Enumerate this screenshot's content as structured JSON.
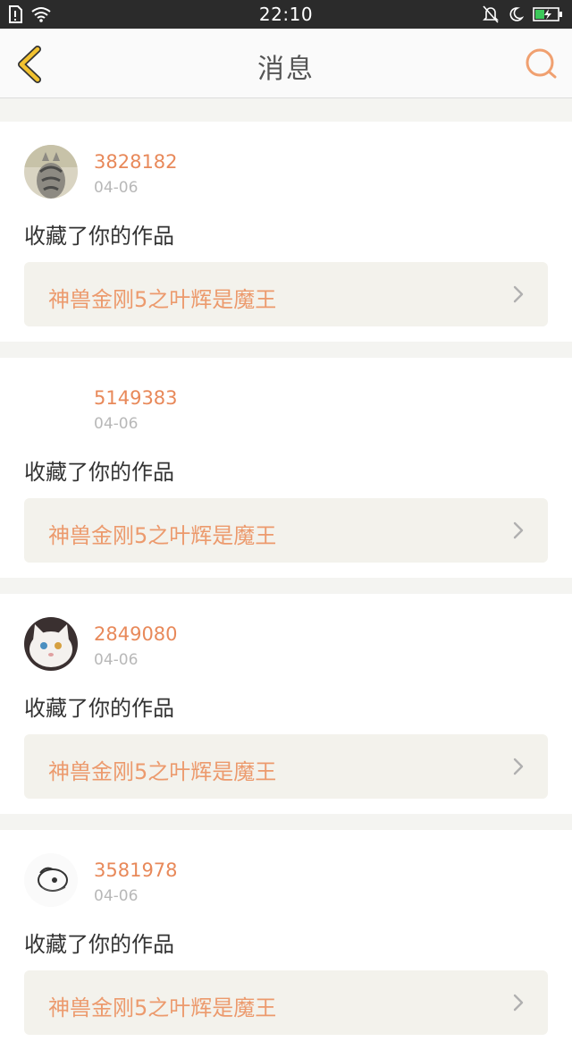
{
  "status_bar": {
    "time": "22:10"
  },
  "header": {
    "title": "消息"
  },
  "messages": [
    {
      "user": "3828182",
      "date": "04-06",
      "action": "收藏了你的作品",
      "work_title": "神兽金刚5之叶辉是魔王",
      "avatar": "cat-photo"
    },
    {
      "user": "5149383",
      "date": "04-06",
      "action": "收藏了你的作品",
      "work_title": "神兽金刚5之叶辉是魔王",
      "avatar": "blank"
    },
    {
      "user": "2849080",
      "date": "04-06",
      "action": "收藏了你的作品",
      "work_title": "神兽金刚5之叶辉是魔王",
      "avatar": "kitten-photo"
    },
    {
      "user": "3581978",
      "date": "04-06",
      "action": "收藏了你的作品",
      "work_title": "神兽金刚5之叶辉是魔王",
      "avatar": "sketch"
    }
  ],
  "colors": {
    "accent": "#e8895a",
    "back_icon": "#f2c230",
    "link_bg": "#f3f2ec"
  }
}
